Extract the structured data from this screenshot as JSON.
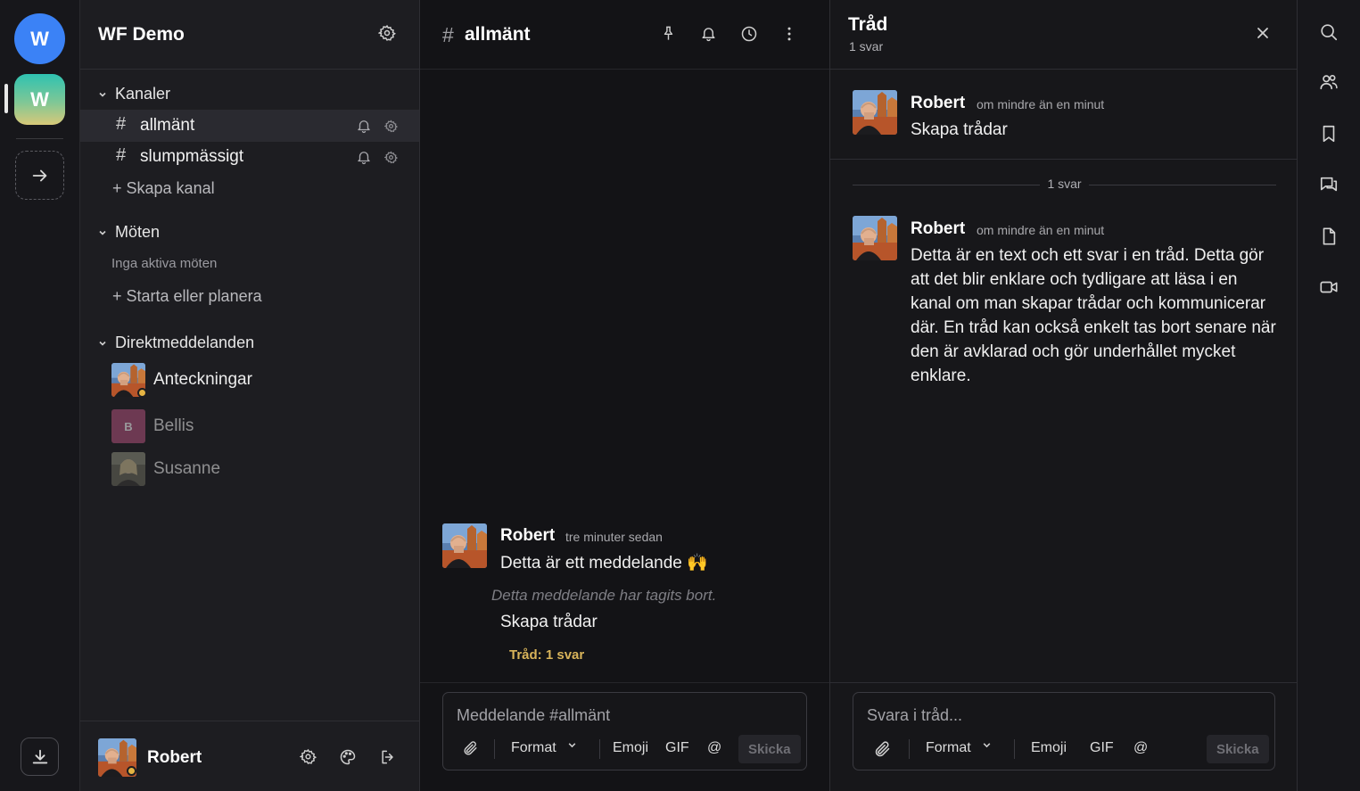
{
  "workspaces": [
    {
      "initial": "W",
      "color": "#3b82f6"
    },
    {
      "initial": "W",
      "active": true
    }
  ],
  "sidebar": {
    "workspace_name": "WF Demo",
    "channels_title": "Kanaler",
    "channels": [
      {
        "name": "allmänt",
        "active": true
      },
      {
        "name": "slumpmässigt",
        "active": false
      }
    ],
    "create_channel": "+ Skapa kanal",
    "meetings_title": "Möten",
    "no_meetings": "Inga aktiva möten",
    "start_meeting": "+ Starta eller planera",
    "dms_title": "Direktmeddelanden",
    "dms": [
      {
        "name": "Anteckningar",
        "status": "away"
      },
      {
        "name": "Bellis",
        "initial": "B",
        "color": "#b0507a"
      },
      {
        "name": "Susanne"
      }
    ],
    "user_name": "Robert"
  },
  "channel": {
    "hash": "#",
    "title": "allmänt",
    "message": {
      "author": "Robert",
      "time": "tre minuter sedan",
      "text": "Detta är ett meddelande 🙌",
      "deleted_text": "Detta meddelande har tagits bort.",
      "followup": "Skapa trådar",
      "thread_link": "Tråd: 1 svar"
    },
    "composer": {
      "placeholder": "Meddelande #allmänt",
      "format": "Format",
      "emoji": "Emoji",
      "gif": "GIF",
      "mention": "@",
      "send": "Skicka"
    }
  },
  "thread": {
    "title": "Tråd",
    "count": "1 svar",
    "parent": {
      "author": "Robert",
      "time": "om mindre än en minut",
      "text": "Skapa trådar"
    },
    "divider": "1 svar",
    "reply": {
      "author": "Robert",
      "time": "om mindre än en minut",
      "text": "Detta är en text och ett svar i en tråd. Detta gör att det blir enklare och tydligare att läsa i en kanal om man skapar trådar och kommunicerar där. En tråd kan också enkelt tas bort senare när den är avklarad och gör underhållet mycket enklare."
    },
    "composer": {
      "placeholder": "Svara i tråd...",
      "format": "Format",
      "emoji": "Emoji",
      "gif": "GIF",
      "mention": "@",
      "send": "Skicka"
    }
  },
  "right_toolbar": [
    "search-icon",
    "members-icon",
    "bookmark-icon",
    "threads-icon",
    "file-icon",
    "video-icon"
  ],
  "colors": {
    "accent": "#3b82f6",
    "thread_link": "#d9b45a",
    "away_status": "#e5b443"
  }
}
